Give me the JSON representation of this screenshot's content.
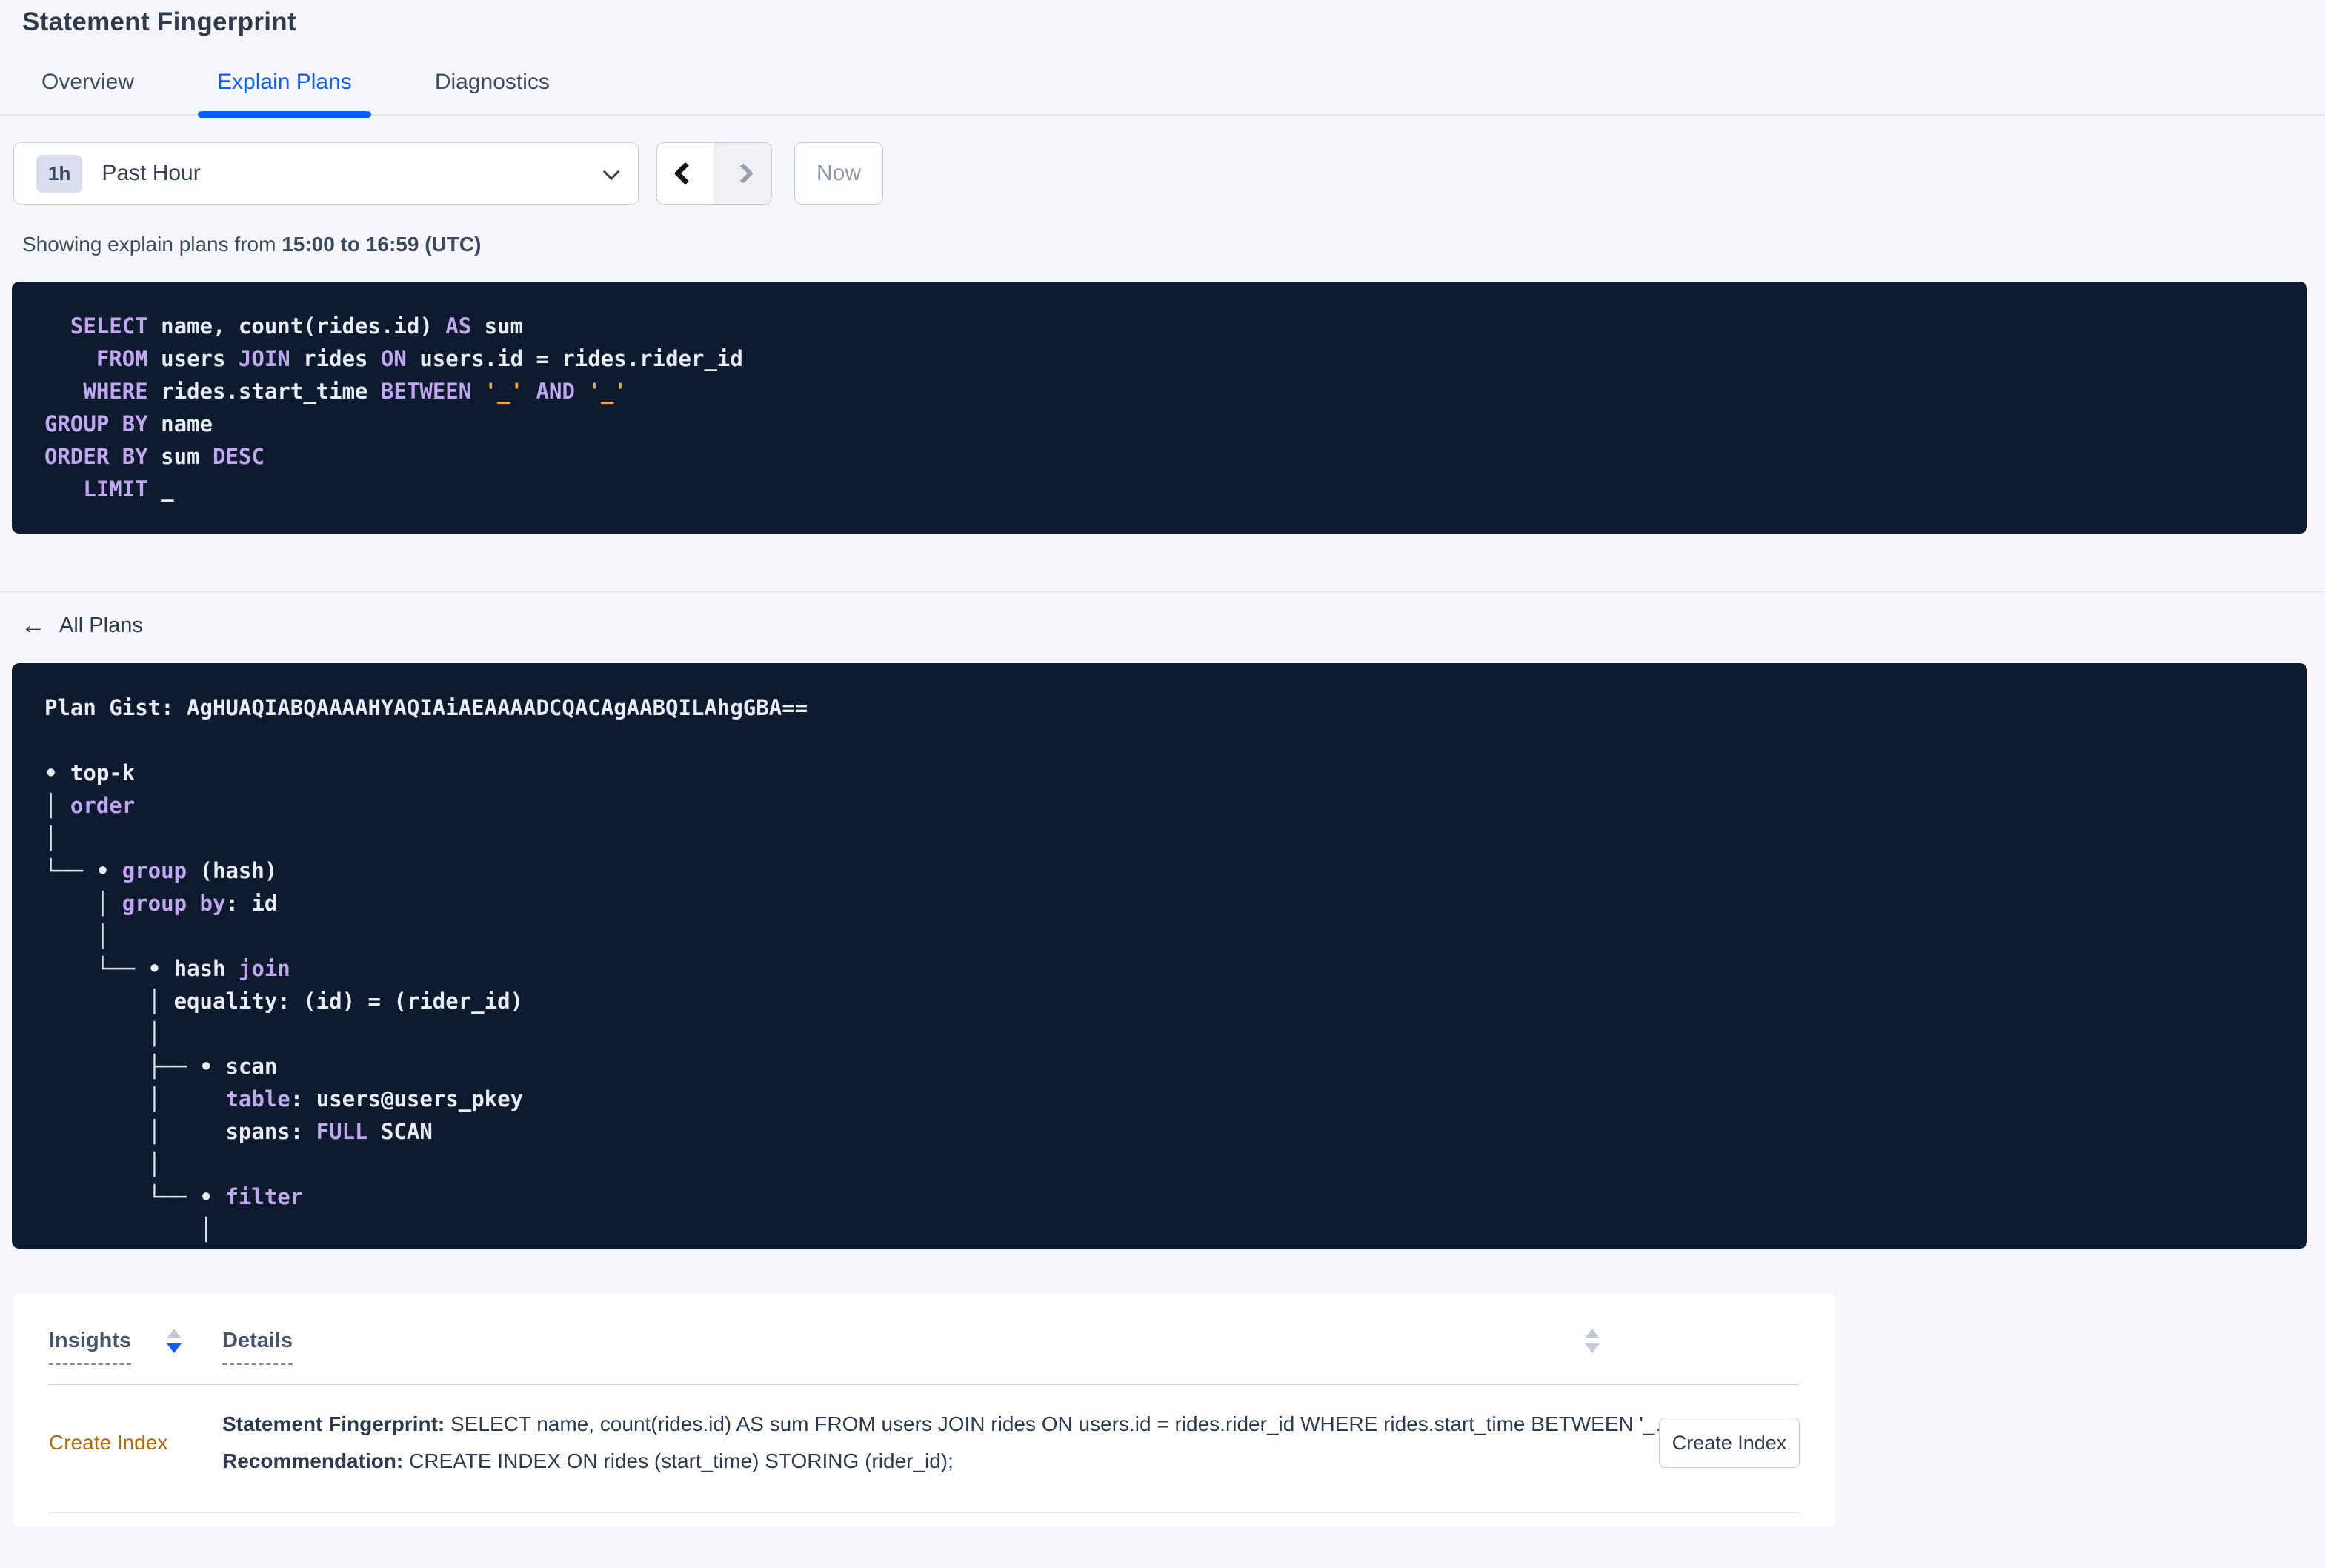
{
  "colors": {
    "accent_blue": "#0b5fff",
    "page_background": "#f4f6fa",
    "code_background": "#0e1a2d",
    "code_keyword_lavender": "#c0a7f0",
    "code_string_orange": "#f0a43e",
    "code_plain": "#e8ecf4",
    "insight_link_orange": "#b4690b",
    "sorter_active_blue": "#0b5fff",
    "sorter_inactive_gray": "#c2cadc"
  },
  "header": {
    "title": "Statement Fingerprint"
  },
  "tabs": [
    {
      "label": "Overview",
      "active": false
    },
    {
      "label": "Explain Plans",
      "active": true
    },
    {
      "label": "Diagnostics",
      "active": false
    }
  ],
  "toolbar": {
    "time_badge": "1h",
    "time_label": "Past Hour",
    "now_label": "Now",
    "icons": [
      "chevron-down-icon",
      "chevron-left-icon",
      "chevron-right-icon"
    ]
  },
  "subtitle": {
    "prefix": "Showing explain plans from ",
    "range_bold": "15:00 to 16:59 (UTC)"
  },
  "sql_block": {
    "lines": [
      [
        [
          "p",
          "  "
        ],
        [
          "k",
          "SELECT"
        ],
        [
          "p",
          " name, count(rides.id) "
        ],
        [
          "k",
          "AS"
        ],
        [
          "p",
          " sum"
        ]
      ],
      [
        [
          "p",
          "    "
        ],
        [
          "k",
          "FROM"
        ],
        [
          "p",
          " users "
        ],
        [
          "k",
          "JOIN"
        ],
        [
          "p",
          " rides "
        ],
        [
          "k",
          "ON"
        ],
        [
          "p",
          " users.id = rides.rider_id"
        ]
      ],
      [
        [
          "p",
          "   "
        ],
        [
          "k",
          "WHERE"
        ],
        [
          "p",
          " rides.start_time "
        ],
        [
          "k",
          "BETWEEN"
        ],
        [
          "p",
          " "
        ],
        [
          "s",
          "'_'"
        ],
        [
          "p",
          " "
        ],
        [
          "k",
          "AND"
        ],
        [
          "p",
          " "
        ],
        [
          "s",
          "'_'"
        ]
      ],
      [
        [
          "k",
          "GROUP BY"
        ],
        [
          "p",
          " name"
        ]
      ],
      [
        [
          "k",
          "ORDER BY"
        ],
        [
          "p",
          " sum "
        ],
        [
          "k",
          "DESC"
        ]
      ],
      [
        [
          "p",
          "   "
        ],
        [
          "k",
          "LIMIT"
        ],
        [
          "p",
          " _"
        ]
      ]
    ]
  },
  "back_link": {
    "label": "All Plans",
    "icon": "arrow-left-icon"
  },
  "gist_block": {
    "lines": [
      [
        [
          "p",
          "Plan Gist: AgHUAQIABQAAAAHYAQIAiAEAAAADCQACAgAABQILAhgGBA=="
        ]
      ],
      [],
      [
        [
          "b",
          "• "
        ],
        [
          "p",
          "top-k"
        ]
      ],
      [
        [
          "t",
          "│ "
        ],
        [
          "k",
          "order"
        ]
      ],
      [
        [
          "t",
          "│"
        ]
      ],
      [
        [
          "t",
          "└── "
        ],
        [
          "b",
          "• "
        ],
        [
          "k",
          "group"
        ],
        [
          "p",
          " (hash)"
        ]
      ],
      [
        [
          "p",
          "    "
        ],
        [
          "t",
          "│ "
        ],
        [
          "k",
          "group by"
        ],
        [
          "p",
          ": id"
        ]
      ],
      [
        [
          "p",
          "    "
        ],
        [
          "t",
          "│"
        ]
      ],
      [
        [
          "p",
          "    "
        ],
        [
          "t",
          "└── "
        ],
        [
          "b",
          "• "
        ],
        [
          "p",
          "hash "
        ],
        [
          "k",
          "join"
        ]
      ],
      [
        [
          "p",
          "        "
        ],
        [
          "t",
          "│ "
        ],
        [
          "p",
          "equality: (id) = (rider_id)"
        ]
      ],
      [
        [
          "p",
          "        "
        ],
        [
          "t",
          "│"
        ]
      ],
      [
        [
          "p",
          "        "
        ],
        [
          "t",
          "├── "
        ],
        [
          "b",
          "• "
        ],
        [
          "p",
          "scan"
        ]
      ],
      [
        [
          "p",
          "        "
        ],
        [
          "t",
          "│"
        ],
        [
          "p",
          "     "
        ],
        [
          "k",
          "table"
        ],
        [
          "p",
          ": users@users_pkey"
        ]
      ],
      [
        [
          "p",
          "        "
        ],
        [
          "t",
          "│"
        ],
        [
          "p",
          "     spans: "
        ],
        [
          "k",
          "FULL"
        ],
        [
          "p",
          " SCAN"
        ]
      ],
      [
        [
          "p",
          "        "
        ],
        [
          "t",
          "│"
        ]
      ],
      [
        [
          "p",
          "        "
        ],
        [
          "t",
          "└── "
        ],
        [
          "b",
          "• "
        ],
        [
          "k",
          "filter"
        ]
      ],
      [
        [
          "p",
          "            "
        ],
        [
          "t",
          "│"
        ]
      ],
      [
        [
          "p",
          "            "
        ],
        [
          "t",
          "│"
        ]
      ]
    ]
  },
  "insights_table": {
    "columns": [
      {
        "label": "Insights",
        "sort": "desc"
      },
      {
        "label": "Details",
        "sort": "none"
      }
    ],
    "rows": [
      {
        "insight": "Create Index",
        "details": {
          "fingerprint_label": "Statement Fingerprint:",
          "fingerprint_text": " SELECT name, count(rides.id) AS sum FROM users JOIN rides ON users.id = rides.rider_id WHERE rides.start_time BETWEEN '_…",
          "recommendation_label": "Recommendation:",
          "recommendation_text": " CREATE INDEX ON rides (start_time) STORING (rider_id);"
        },
        "action_label": "Create Index"
      }
    ]
  }
}
